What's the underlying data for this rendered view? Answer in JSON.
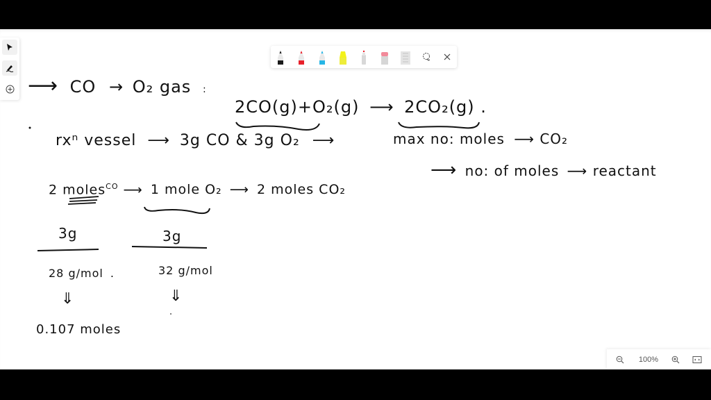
{
  "left_toolbar": {
    "tools": [
      {
        "name": "select",
        "icon": "cursor-arrow-icon",
        "active": true
      },
      {
        "name": "pen",
        "icon": "pen-icon",
        "active": true
      },
      {
        "name": "add",
        "icon": "plus-circle-icon",
        "active": false
      }
    ]
  },
  "pen_toolbar": {
    "pens": [
      {
        "name": "black pen",
        "color": "#1a1a1a"
      },
      {
        "name": "red pen",
        "color": "#e8212b"
      },
      {
        "name": "cyan pen",
        "color": "#27b6e6"
      },
      {
        "name": "yellow highlighter",
        "color": "#f3f21a"
      },
      {
        "name": "pointer pen",
        "color": "#d8d8d8"
      },
      {
        "name": "eraser",
        "color": "#f28a9a"
      },
      {
        "name": "ruler",
        "color": "#cfcfcf"
      }
    ],
    "lasso_icon": "lasso-icon",
    "close_icon": "close-icon"
  },
  "zoom_bar": {
    "zoom_out_icon": "zoom-out-icon",
    "zoom_level": "100%",
    "zoom_in_icon": "zoom-in-icon",
    "fit_icon": "fit-to-screen-icon"
  },
  "notes": {
    "line1": {
      "arrow": "⟶",
      "a": "CO",
      "arrow2": "→",
      "b": "O₂ gas",
      "tail": ":"
    },
    "equation": {
      "left": "2CO(g)+O₂(g)",
      "arrow": "⟶",
      "right": "2CO₂(g)",
      "tail": "."
    },
    "line2": {
      "lead": "rxⁿ vessel",
      "arrow": "⟶",
      "mid": "3g CO & 3g O₂",
      "arrow2": "⟶"
    },
    "line2b": {
      "lead": "max no: moles",
      "arrow": "⟶",
      "tail": "CO₂"
    },
    "line2c": {
      "arrow": "⟶",
      "lead": "no: of moles",
      "arrow2": "⟶",
      "tail": "reactant"
    },
    "line3": {
      "a": "2 moles",
      "a_sup": "CO",
      "arrow": "⟶",
      "b": "1 mole O₂",
      "arrow2": "⟶",
      "c": "2 moles CO₂"
    },
    "frac1": {
      "num": "3g",
      "den": "28 g/mol",
      "tail": "."
    },
    "frac2": {
      "num": "3g",
      "den": "32 g/mol"
    },
    "arrow_down": "⇓",
    "result1": "0.107 moles"
  }
}
